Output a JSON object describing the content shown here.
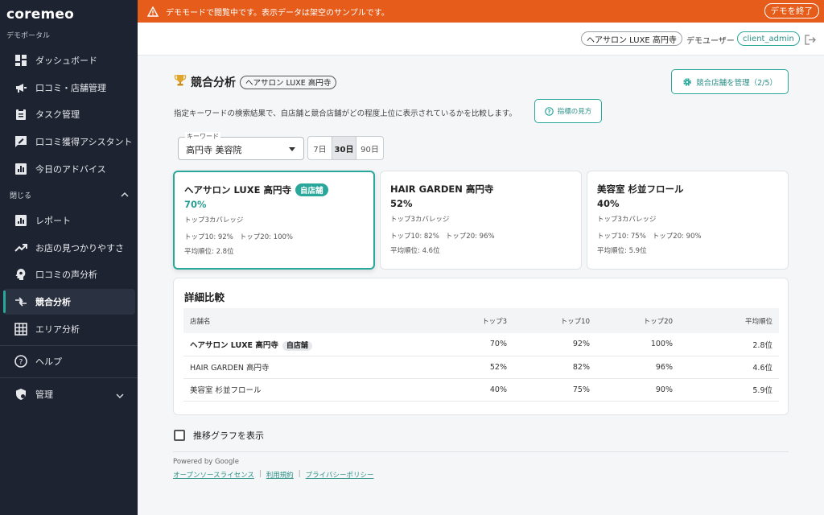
{
  "app": {
    "brand": "coremeo",
    "portal": "デモポータル"
  },
  "banner": {
    "message": "デモモードで閲覧中です。表示データは架空のサンプルです。",
    "exit_label": "デモを終了"
  },
  "topbar": {
    "store": "ヘアサロン LUXE 高円寺",
    "user_label": "デモユーザー",
    "username": "client_admin"
  },
  "sidebar": {
    "items": [
      {
        "label": "ダッシュボード",
        "icon": "dashboard-icon"
      },
      {
        "label": "口コミ・店舗管理",
        "icon": "megaphone-icon"
      },
      {
        "label": "タスク管理",
        "icon": "clipboard-icon"
      },
      {
        "label": "口コミ獲得アシスタント",
        "icon": "review-edit-icon"
      },
      {
        "label": "今日のアドバイス",
        "icon": "chart-box-icon"
      }
    ],
    "section_label": "閉じる",
    "section_items": [
      {
        "label": "レポート",
        "icon": "bar-chart-icon"
      },
      {
        "label": "お店の見つかりやすさ",
        "icon": "trending-up-icon"
      },
      {
        "label": "口コミの声分析",
        "icon": "head-icon"
      },
      {
        "label": "競合分析",
        "icon": "compare-arrows-icon"
      },
      {
        "label": "エリア分析",
        "icon": "grid-icon"
      }
    ],
    "help": "ヘルプ",
    "admin": "管理"
  },
  "page": {
    "title": "競合分析",
    "store_chip": "ヘアサロン LUXE 高円寺",
    "manage_button": "競合店舗を管理（2/5）",
    "description": "指定キーワードの検索結果で、自店舗と競合店舗がどの程度上位に表示されているかを比較します。",
    "guide_button": "指標の見方",
    "keyword_label": "キーワード",
    "keyword_value": "高円寺 美容院",
    "periods": [
      "7日",
      "30日",
      "90日"
    ],
    "selected_period": "30日"
  },
  "cards": [
    {
      "name": "ヘアサロン LUXE 高円寺",
      "badge": "自店舗",
      "pct": "70%",
      "sub": "トップ3カバレッジ",
      "top10": "トップ10: 92%",
      "top20": "トップ20: 100%",
      "avg": "平均順位: 2.8位"
    },
    {
      "name": "HAIR GARDEN 高円寺",
      "pct": "52%",
      "sub": "トップ3カバレッジ",
      "top10": "トップ10: 82%",
      "top20": "トップ20: 96%",
      "avg": "平均順位: 4.6位"
    },
    {
      "name": "美容室 杉並フロール",
      "pct": "40%",
      "sub": "トップ3カバレッジ",
      "top10": "トップ10: 75%",
      "top20": "トップ20: 90%",
      "avg": "平均順位: 5.9位"
    }
  ],
  "detail": {
    "title": "詳細比較",
    "headers": [
      "店舗名",
      "トップ3",
      "トップ10",
      "トップ20",
      "平均順位"
    ],
    "rows": [
      {
        "name": "ヘアサロン LUXE 高円寺",
        "badge": "自店舗",
        "top3": "70%",
        "top10": "92%",
        "top20": "100%",
        "avg": "2.8位"
      },
      {
        "name": "HAIR GARDEN 高円寺",
        "top3": "52%",
        "top10": "82%",
        "top20": "96%",
        "avg": "4.6位"
      },
      {
        "name": "美容室 杉並フロール",
        "top3": "40%",
        "top10": "75%",
        "top20": "90%",
        "avg": "5.9位"
      }
    ]
  },
  "trend_label": "推移グラフを表示",
  "footer": {
    "powered": "Powered by Google",
    "links": [
      "オープンソースライセンス",
      "利用規約",
      "プライバシーポリシー"
    ]
  },
  "colors": {
    "accent": "#2aa79b",
    "banner": "#e65c1a",
    "sidebar": "#1d2330"
  }
}
